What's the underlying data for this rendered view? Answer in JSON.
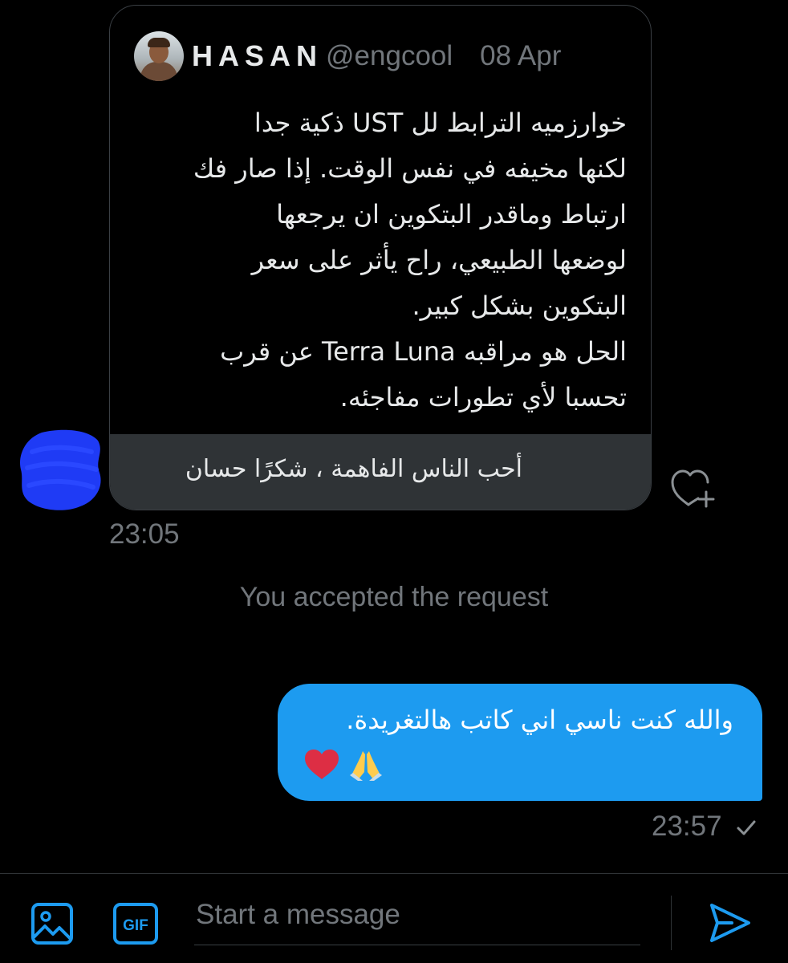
{
  "quoted_tweet": {
    "author_name": "HASAN",
    "author_handle": "@engcool",
    "date": "08 Apr",
    "text": "خوارزميه الترابط لل UST ذكية جدا\nلكنها مخيفه في نفس الوقت. إذا صار فك\nارتباط وماقدر البتكوين ان يرجعها\nلوضعها الطبيعي، راح يأثر على سعر\nالبتكوين بشكل كبير.\nالحل هو مراقبه Terra Luna عن قرب\nتحسبا لأي تطورات مفاجئه."
  },
  "received_message": {
    "text": "أحب الناس الفاهمة ، شكرًا حسان",
    "time": "23:05"
  },
  "system_note": "You accepted the request",
  "sent_message": {
    "text": "والله كنت ناسي اني كاتب هالتغريدة.",
    "emoji": [
      "praying-hands",
      "red-heart"
    ],
    "time": "23:57",
    "status": "sent"
  },
  "composer": {
    "placeholder": "Start a message",
    "gif_label": "GIF"
  },
  "colors": {
    "accent": "#1d9bf0",
    "background": "#000000",
    "muted_text": "#71767b",
    "strip": "#2f3336",
    "redaction": "#1f3bf5"
  },
  "icons": [
    "heart-plus-icon",
    "check-icon",
    "image-icon",
    "gif-icon",
    "send-icon"
  ]
}
